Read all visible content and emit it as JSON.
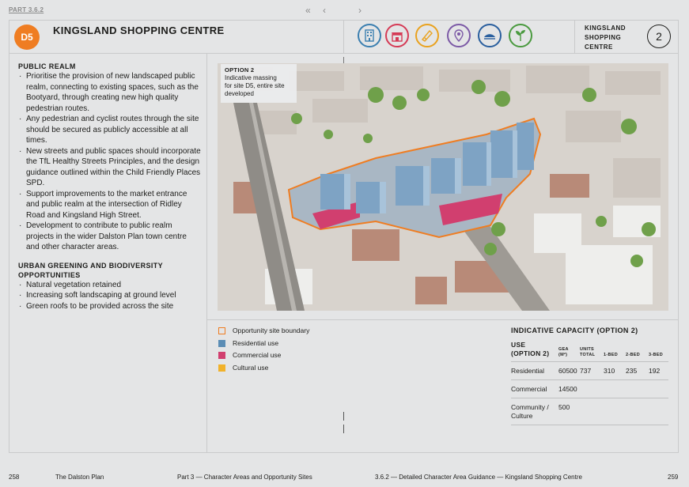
{
  "nav": {
    "part_label": "PART 3.6.2",
    "first": "«",
    "prev": "‹",
    "next": "›"
  },
  "header": {
    "site_code": "D5",
    "site_title": "KINGSLAND SHOPPING CENTRE",
    "area_name": "KINGSLAND\nSHOPPING\nCENTRE",
    "area_number": "2",
    "icons": [
      {
        "name": "residential-icon",
        "color": "#3b7fb0"
      },
      {
        "name": "commercial-icon",
        "color": "#d53b56"
      },
      {
        "name": "cultural-icon",
        "color": "#e9a21f"
      },
      {
        "name": "location-icon",
        "color": "#7c5aa6"
      },
      {
        "name": "transport-icon",
        "color": "#2a5f9e"
      },
      {
        "name": "greening-icon",
        "color": "#4a9a3f"
      }
    ]
  },
  "public_realm": {
    "heading": "PUBLIC REALM",
    "items": [
      "Prioritise the provision of new landscaped  public realm, connecting to  existing spaces, such as the Bootyard, through creating new high quality pedestrian routes.",
      "Any pedestrian and cyclist routes through the site should be secured as publicly accessible at all times.",
      "New streets and public spaces should incorporate the TfL Healthy Streets Principles, and the design guidance outlined within the Child Friendly Places SPD.",
      "Support improvements to the market entrance and public realm at the intersection of Ridley Road and Kingsland High Street.",
      "Development to contribute to public realm projects in the wider Dalston Plan town centre and other character areas."
    ]
  },
  "urban_greening": {
    "heading": "URBAN GREENING AND BIODIVERSITY OPPORTUNITIES",
    "items": [
      "Natural vegetation retained",
      "Increasing soft landscaping at ground level",
      "Green roofs to be provided  across the site"
    ]
  },
  "map": {
    "option_title": "OPTION 2",
    "option_desc": "Indicative massing\nfor site D5, entire site\ndeveloped"
  },
  "legend": [
    {
      "label": "Opportunity site boundary",
      "color": "#ef7d22",
      "style": "outline"
    },
    {
      "label": "Residential use",
      "color": "#5b8db5",
      "style": "fill"
    },
    {
      "label": "Commercial use",
      "color": "#d13f6f",
      "style": "fill"
    },
    {
      "label": "Cultural use",
      "color": "#f1b22b",
      "style": "fill"
    }
  ],
  "capacity": {
    "title": "INDICATIVE CAPACITY (OPTION 2)",
    "headers": {
      "use": "USE\n(OPTION 2)",
      "gea": "GEA\n(M²)",
      "units": "UNITS\nTOTAL",
      "bed1": "1-BED",
      "bed2": "2-BED",
      "bed3": "3-BED"
    },
    "rows": [
      {
        "use": "Residential",
        "gea": "60500",
        "units": "737",
        "bed1": "310",
        "bed2": "235",
        "bed3": "192"
      },
      {
        "use": "Commercial",
        "gea": "14500",
        "units": "",
        "bed1": "",
        "bed2": "",
        "bed3": ""
      },
      {
        "use": "Community /\nCulture",
        "gea": "500",
        "units": "",
        "bed1": "",
        "bed2": "",
        "bed3": ""
      }
    ]
  },
  "footer": {
    "page_left": "258",
    "plan_name": "The Dalston Plan",
    "part": "Part 3 — Character Areas and Opportunity Sites",
    "section": "3.6.2 — Detailed Character Area Guidance — Kingsland Shopping Centre",
    "page_right": "259"
  }
}
